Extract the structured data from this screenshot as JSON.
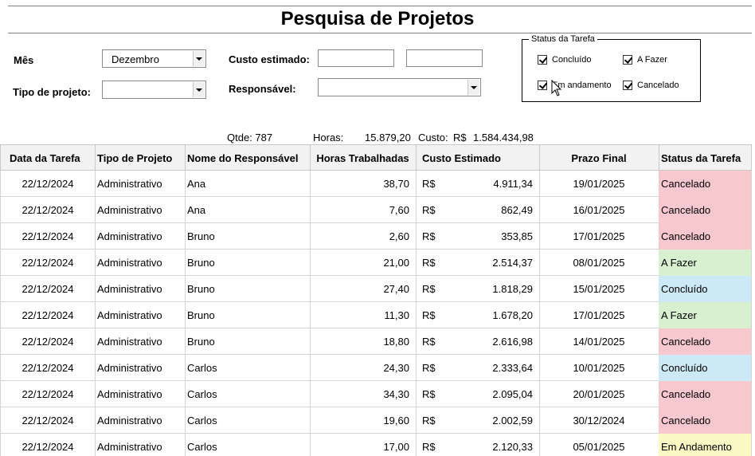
{
  "title": "Pesquisa de Projetos",
  "filters": {
    "mes_label": "Mês",
    "mes_value": "Dezembro",
    "tipo_label": "Tipo de projeto:",
    "tipo_value": "",
    "custo_label": "Custo estimado:",
    "custo_min": "",
    "custo_max": "",
    "resp_label": "Responsável:",
    "resp_value": ""
  },
  "status_group": {
    "title": "Status da Tarefa",
    "options": [
      {
        "label": "Concluído",
        "checked": true
      },
      {
        "label": "A Fazer",
        "checked": true
      },
      {
        "label": "Em andamento",
        "checked": true
      },
      {
        "label": "Cancelado",
        "checked": true
      }
    ]
  },
  "summary": {
    "qtde": "Qtde: 787",
    "horas_label": "Horas:",
    "horas_value": "15.879,20",
    "custo_label": "Custo:",
    "custo_currency": "R$",
    "custo_value": "1.584.434,98"
  },
  "table": {
    "headers": [
      "Data da Tarefa",
      "Tipo de Projeto",
      "Nome do Responsável",
      "Horas Trabalhadas",
      "Custo Estimado",
      "Prazo Final",
      "Status da Tarefa"
    ],
    "rows": [
      {
        "data": "22/12/2024",
        "tipo": "Administrativo",
        "nome": "Ana",
        "horas": "38,70",
        "moeda": "R$",
        "custo": "4.911,34",
        "prazo": "19/01/2025",
        "status": "Cancelado"
      },
      {
        "data": "22/12/2024",
        "tipo": "Administrativo",
        "nome": "Ana",
        "horas": "7,60",
        "moeda": "R$",
        "custo": "862,49",
        "prazo": "16/01/2025",
        "status": "Cancelado"
      },
      {
        "data": "22/12/2024",
        "tipo": "Administrativo",
        "nome": "Bruno",
        "horas": "2,60",
        "moeda": "R$",
        "custo": "353,85",
        "prazo": "17/01/2025",
        "status": "Cancelado"
      },
      {
        "data": "22/12/2024",
        "tipo": "Administrativo",
        "nome": "Bruno",
        "horas": "21,00",
        "moeda": "R$",
        "custo": "2.514,37",
        "prazo": "08/01/2025",
        "status": "A Fazer"
      },
      {
        "data": "22/12/2024",
        "tipo": "Administrativo",
        "nome": "Bruno",
        "horas": "27,40",
        "moeda": "R$",
        "custo": "1.818,29",
        "prazo": "15/01/2025",
        "status": "Concluído"
      },
      {
        "data": "22/12/2024",
        "tipo": "Administrativo",
        "nome": "Bruno",
        "horas": "11,30",
        "moeda": "R$",
        "custo": "1.678,20",
        "prazo": "17/01/2025",
        "status": "A Fazer"
      },
      {
        "data": "22/12/2024",
        "tipo": "Administrativo",
        "nome": "Bruno",
        "horas": "18,80",
        "moeda": "R$",
        "custo": "2.616,98",
        "prazo": "14/01/2025",
        "status": "Cancelado"
      },
      {
        "data": "22/12/2024",
        "tipo": "Administrativo",
        "nome": "Carlos",
        "horas": "24,30",
        "moeda": "R$",
        "custo": "2.333,64",
        "prazo": "10/01/2025",
        "status": "Concluído"
      },
      {
        "data": "22/12/2024",
        "tipo": "Administrativo",
        "nome": "Carlos",
        "horas": "34,30",
        "moeda": "R$",
        "custo": "2.095,04",
        "prazo": "20/01/2025",
        "status": "Cancelado"
      },
      {
        "data": "22/12/2024",
        "tipo": "Administrativo",
        "nome": "Carlos",
        "horas": "19,60",
        "moeda": "R$",
        "custo": "2.002,59",
        "prazo": "30/12/2024",
        "status": "Cancelado"
      },
      {
        "data": "22/12/2024",
        "tipo": "Administrativo",
        "nome": "Carlos",
        "horas": "17,00",
        "moeda": "R$",
        "custo": "2.120,33",
        "prazo": "05/01/2025",
        "status": "Em Andamento"
      }
    ]
  },
  "status_colors": {
    "Cancelado": "#f8c8cf",
    "A Fazer": "#d8f0cf",
    "Concluído": "#cde9f5",
    "Em Andamento": "#fcf9c4"
  }
}
